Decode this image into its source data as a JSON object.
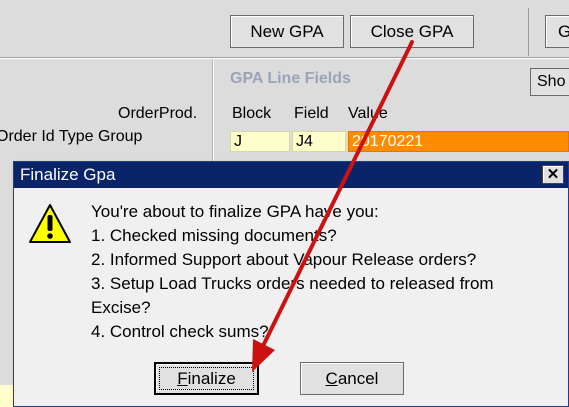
{
  "toolbar": {
    "new_gpa": "New GPA",
    "close_gpa": "Close GPA",
    "right_cut": "G"
  },
  "order_table": {
    "header_top": "OrderProd.",
    "header_bottom": "Order Id Type  Group"
  },
  "gpa_line_fields": {
    "title": "GPA Line Fields",
    "show_button": "Sho",
    "columns": [
      "Block",
      "Field",
      "Value"
    ],
    "row": [
      "J",
      "J4",
      "20170221"
    ]
  },
  "dialog": {
    "title": "Finalize Gpa",
    "close_glyph": "✕",
    "icon": "warning-icon",
    "lines": [
      "You're about to finalize GPA have you:",
      "1. Checked missing documents?",
      "2. Informed Support about Vapour Release orders?",
      "3. Setup Load Trucks orders needed to released from",
      "Excise?",
      "4. Control check sums?"
    ],
    "finalize_mnemonic": "F",
    "finalize_rest": "inalize",
    "cancel_mnemonic": "C",
    "cancel_rest": "ancel"
  },
  "colors": {
    "title_bar": "#0a246a",
    "highlight_orange": "#ff8c00",
    "cell_yellow": "#ffffcc",
    "annotation_arrow": "#cc1111"
  }
}
